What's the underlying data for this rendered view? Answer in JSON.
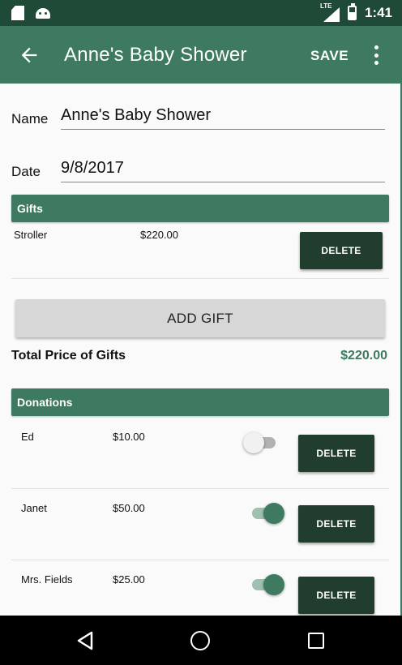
{
  "status_bar": {
    "network_label": "LTE",
    "time": "1:41",
    "icons": [
      "sd-card-icon",
      "android-icon",
      "signal-icon",
      "battery-icon"
    ]
  },
  "app_bar": {
    "back_icon": "arrow-back-icon",
    "title": "Anne's Baby Shower",
    "save_label": "SAVE",
    "more_icon": "more-vert-icon"
  },
  "form": {
    "name_label": "Name",
    "name_value": "Anne's Baby Shower",
    "date_label": "Date",
    "date_value": "9/8/2017"
  },
  "gifts": {
    "header": "Gifts",
    "items": [
      {
        "name": "Stroller",
        "price": "$220.00",
        "delete_label": "DELETE"
      }
    ],
    "add_label": "ADD GIFT",
    "total_label": "Total Price of Gifts",
    "total_value": "$220.00"
  },
  "donations": {
    "header": "Donations",
    "items": [
      {
        "name": "Ed",
        "amount": "$10.00",
        "received": false,
        "delete_label": "DELETE"
      },
      {
        "name": "Janet",
        "amount": "$50.00",
        "received": true,
        "delete_label": "DELETE"
      },
      {
        "name": "Mrs. Fields",
        "amount": "$25.00",
        "received": true,
        "delete_label": "DELETE"
      }
    ]
  },
  "colors": {
    "primary": "#3d7a5f",
    "primary_dark": "#1f4a38",
    "button_dark": "#213d2e",
    "total_price": "#3d7a5f"
  },
  "nav_bar": {
    "icons": [
      "nav-back-icon",
      "nav-home-icon",
      "nav-recents-icon"
    ]
  }
}
